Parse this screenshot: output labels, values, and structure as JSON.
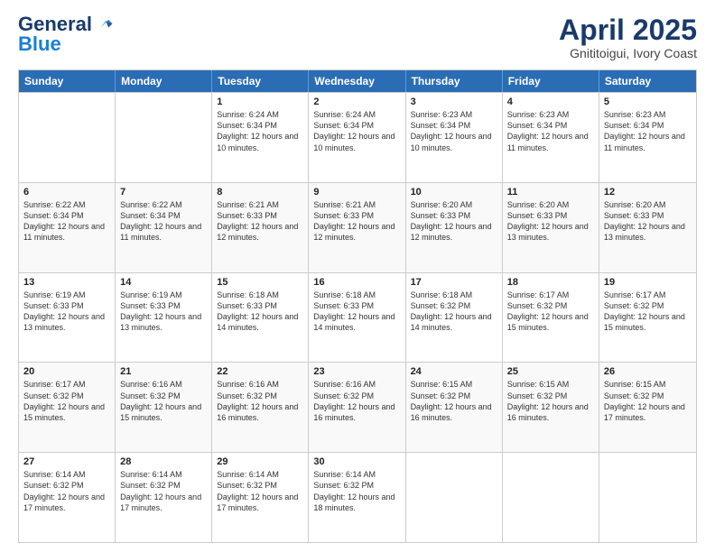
{
  "logo": {
    "general": "General",
    "blue": "Blue"
  },
  "title": {
    "month": "April 2025",
    "location": "Gnititoigui, Ivory Coast"
  },
  "header": {
    "days": [
      "Sunday",
      "Monday",
      "Tuesday",
      "Wednesday",
      "Thursday",
      "Friday",
      "Saturday"
    ]
  },
  "weeks": [
    [
      {
        "day": "",
        "sunrise": "",
        "sunset": "",
        "daylight": ""
      },
      {
        "day": "",
        "sunrise": "",
        "sunset": "",
        "daylight": ""
      },
      {
        "day": "1",
        "sunrise": "Sunrise: 6:24 AM",
        "sunset": "Sunset: 6:34 PM",
        "daylight": "Daylight: 12 hours and 10 minutes."
      },
      {
        "day": "2",
        "sunrise": "Sunrise: 6:24 AM",
        "sunset": "Sunset: 6:34 PM",
        "daylight": "Daylight: 12 hours and 10 minutes."
      },
      {
        "day": "3",
        "sunrise": "Sunrise: 6:23 AM",
        "sunset": "Sunset: 6:34 PM",
        "daylight": "Daylight: 12 hours and 10 minutes."
      },
      {
        "day": "4",
        "sunrise": "Sunrise: 6:23 AM",
        "sunset": "Sunset: 6:34 PM",
        "daylight": "Daylight: 12 hours and 11 minutes."
      },
      {
        "day": "5",
        "sunrise": "Sunrise: 6:23 AM",
        "sunset": "Sunset: 6:34 PM",
        "daylight": "Daylight: 12 hours and 11 minutes."
      }
    ],
    [
      {
        "day": "6",
        "sunrise": "Sunrise: 6:22 AM",
        "sunset": "Sunset: 6:34 PM",
        "daylight": "Daylight: 12 hours and 11 minutes."
      },
      {
        "day": "7",
        "sunrise": "Sunrise: 6:22 AM",
        "sunset": "Sunset: 6:34 PM",
        "daylight": "Daylight: 12 hours and 11 minutes."
      },
      {
        "day": "8",
        "sunrise": "Sunrise: 6:21 AM",
        "sunset": "Sunset: 6:33 PM",
        "daylight": "Daylight: 12 hours and 12 minutes."
      },
      {
        "day": "9",
        "sunrise": "Sunrise: 6:21 AM",
        "sunset": "Sunset: 6:33 PM",
        "daylight": "Daylight: 12 hours and 12 minutes."
      },
      {
        "day": "10",
        "sunrise": "Sunrise: 6:20 AM",
        "sunset": "Sunset: 6:33 PM",
        "daylight": "Daylight: 12 hours and 12 minutes."
      },
      {
        "day": "11",
        "sunrise": "Sunrise: 6:20 AM",
        "sunset": "Sunset: 6:33 PM",
        "daylight": "Daylight: 12 hours and 13 minutes."
      },
      {
        "day": "12",
        "sunrise": "Sunrise: 6:20 AM",
        "sunset": "Sunset: 6:33 PM",
        "daylight": "Daylight: 12 hours and 13 minutes."
      }
    ],
    [
      {
        "day": "13",
        "sunrise": "Sunrise: 6:19 AM",
        "sunset": "Sunset: 6:33 PM",
        "daylight": "Daylight: 12 hours and 13 minutes."
      },
      {
        "day": "14",
        "sunrise": "Sunrise: 6:19 AM",
        "sunset": "Sunset: 6:33 PM",
        "daylight": "Daylight: 12 hours and 13 minutes."
      },
      {
        "day": "15",
        "sunrise": "Sunrise: 6:18 AM",
        "sunset": "Sunset: 6:33 PM",
        "daylight": "Daylight: 12 hours and 14 minutes."
      },
      {
        "day": "16",
        "sunrise": "Sunrise: 6:18 AM",
        "sunset": "Sunset: 6:33 PM",
        "daylight": "Daylight: 12 hours and 14 minutes."
      },
      {
        "day": "17",
        "sunrise": "Sunrise: 6:18 AM",
        "sunset": "Sunset: 6:32 PM",
        "daylight": "Daylight: 12 hours and 14 minutes."
      },
      {
        "day": "18",
        "sunrise": "Sunrise: 6:17 AM",
        "sunset": "Sunset: 6:32 PM",
        "daylight": "Daylight: 12 hours and 15 minutes."
      },
      {
        "day": "19",
        "sunrise": "Sunrise: 6:17 AM",
        "sunset": "Sunset: 6:32 PM",
        "daylight": "Daylight: 12 hours and 15 minutes."
      }
    ],
    [
      {
        "day": "20",
        "sunrise": "Sunrise: 6:17 AM",
        "sunset": "Sunset: 6:32 PM",
        "daylight": "Daylight: 12 hours and 15 minutes."
      },
      {
        "day": "21",
        "sunrise": "Sunrise: 6:16 AM",
        "sunset": "Sunset: 6:32 PM",
        "daylight": "Daylight: 12 hours and 15 minutes."
      },
      {
        "day": "22",
        "sunrise": "Sunrise: 6:16 AM",
        "sunset": "Sunset: 6:32 PM",
        "daylight": "Daylight: 12 hours and 16 minutes."
      },
      {
        "day": "23",
        "sunrise": "Sunrise: 6:16 AM",
        "sunset": "Sunset: 6:32 PM",
        "daylight": "Daylight: 12 hours and 16 minutes."
      },
      {
        "day": "24",
        "sunrise": "Sunrise: 6:15 AM",
        "sunset": "Sunset: 6:32 PM",
        "daylight": "Daylight: 12 hours and 16 minutes."
      },
      {
        "day": "25",
        "sunrise": "Sunrise: 6:15 AM",
        "sunset": "Sunset: 6:32 PM",
        "daylight": "Daylight: 12 hours and 16 minutes."
      },
      {
        "day": "26",
        "sunrise": "Sunrise: 6:15 AM",
        "sunset": "Sunset: 6:32 PM",
        "daylight": "Daylight: 12 hours and 17 minutes."
      }
    ],
    [
      {
        "day": "27",
        "sunrise": "Sunrise: 6:14 AM",
        "sunset": "Sunset: 6:32 PM",
        "daylight": "Daylight: 12 hours and 17 minutes."
      },
      {
        "day": "28",
        "sunrise": "Sunrise: 6:14 AM",
        "sunset": "Sunset: 6:32 PM",
        "daylight": "Daylight: 12 hours and 17 minutes."
      },
      {
        "day": "29",
        "sunrise": "Sunrise: 6:14 AM",
        "sunset": "Sunset: 6:32 PM",
        "daylight": "Daylight: 12 hours and 17 minutes."
      },
      {
        "day": "30",
        "sunrise": "Sunrise: 6:14 AM",
        "sunset": "Sunset: 6:32 PM",
        "daylight": "Daylight: 12 hours and 18 minutes."
      },
      {
        "day": "",
        "sunrise": "",
        "sunset": "",
        "daylight": ""
      },
      {
        "day": "",
        "sunrise": "",
        "sunset": "",
        "daylight": ""
      },
      {
        "day": "",
        "sunrise": "",
        "sunset": "",
        "daylight": ""
      }
    ]
  ]
}
